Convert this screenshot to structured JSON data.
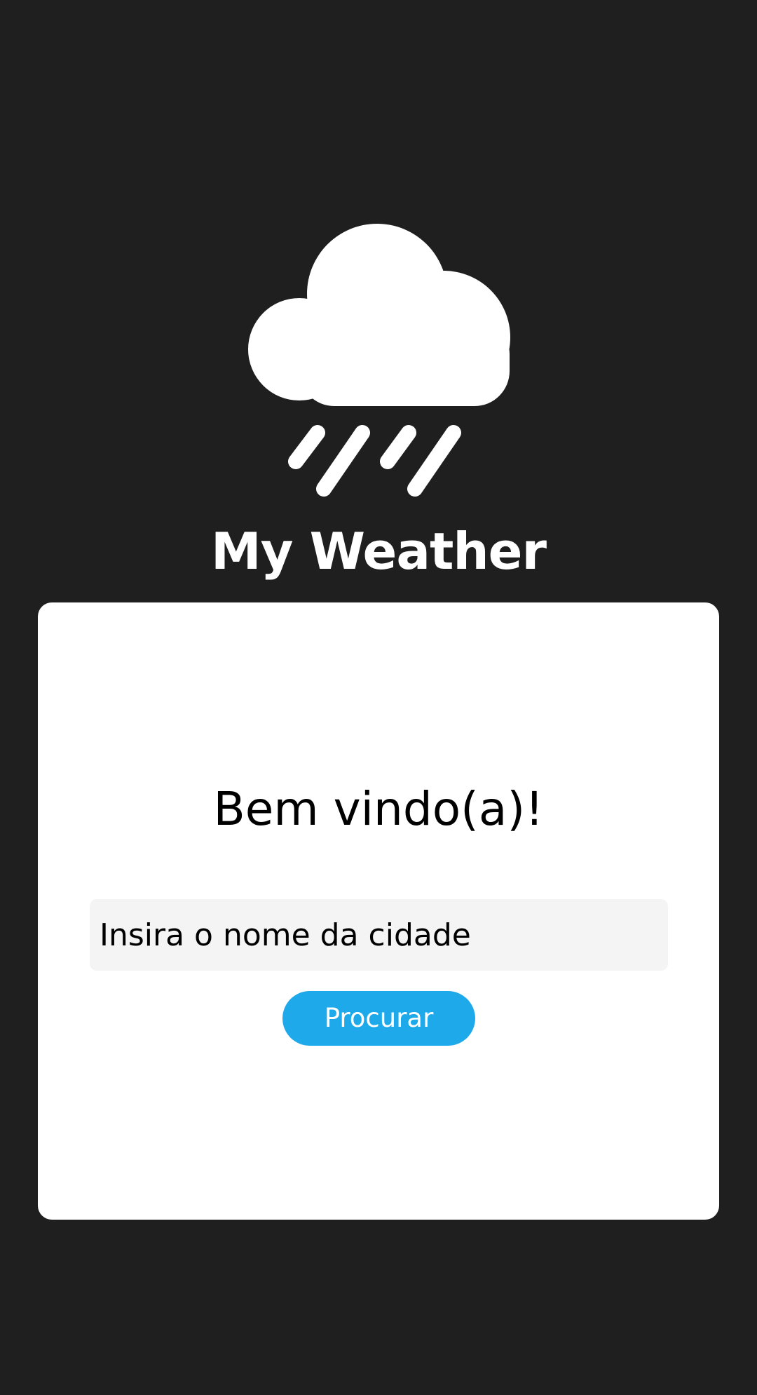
{
  "app": {
    "title": "My Weather",
    "logo_icon": "cloud-rain-icon"
  },
  "card": {
    "welcome": "Bem vindo(a)!",
    "city_input": {
      "value": "",
      "placeholder": "Insira o nome da cidade"
    },
    "search_button_label": "Procurar"
  },
  "colors": {
    "background": "#1f1f1f",
    "card": "#ffffff",
    "input_background": "#f4f4f4",
    "button": "#1ea9ea",
    "title": "#ffffff"
  }
}
